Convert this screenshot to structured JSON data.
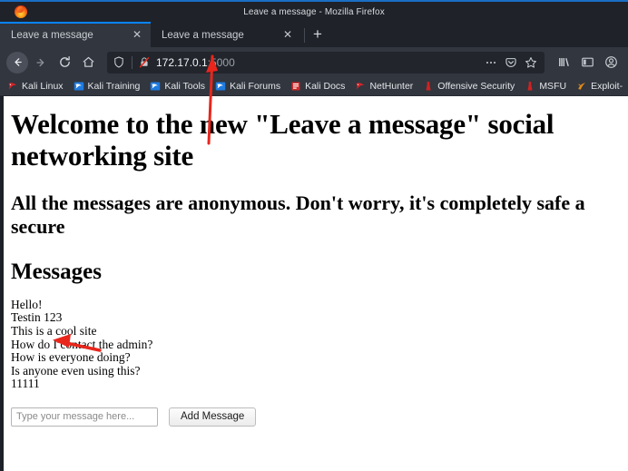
{
  "window": {
    "title": "Leave a message - Mozilla Firefox",
    "logo_icon": "firefox-logo"
  },
  "tabs": {
    "items": [
      {
        "label": "Leave a message",
        "close_icon": "close-icon",
        "active": true
      },
      {
        "label": "Leave a message",
        "close_icon": "close-icon",
        "active": false
      }
    ],
    "new_tab_label": "+"
  },
  "toolbar": {
    "back_icon": "back-arrow-icon",
    "forward_icon": "forward-arrow-icon",
    "reload_icon": "reload-icon",
    "home_icon": "home-icon",
    "shield_icon": "shield-icon",
    "lock_broken_icon": "lock-broken-icon",
    "url_host": "172.17.0.1",
    "url_port": ":5000",
    "page_actions_icon": "ellipsis-icon",
    "pocket_icon": "pocket-icon",
    "bookmark_star_icon": "star-icon",
    "library_icon": "library-icon",
    "sidebar_icon": "sidebar-icon",
    "account_icon": "account-icon"
  },
  "bookmarks": [
    {
      "label": "Kali Linux",
      "icon": "kali-dragon-icon"
    },
    {
      "label": "Kali Training",
      "icon": "kali-blue-icon"
    },
    {
      "label": "Kali Tools",
      "icon": "kali-blue-icon"
    },
    {
      "label": "Kali Forums",
      "icon": "kali-blue-icon"
    },
    {
      "label": "Kali Docs",
      "icon": "kali-docs-icon"
    },
    {
      "label": "NetHunter",
      "icon": "nethunter-icon"
    },
    {
      "label": "Offensive Security",
      "icon": "offsec-icon"
    },
    {
      "label": "MSFU",
      "icon": "offsec-icon"
    },
    {
      "label": "Exploit-",
      "icon": "exploitdb-icon"
    }
  ],
  "page": {
    "heading_line1": "Welcome to the new \"Leave a message\" social",
    "heading_line2": "networking site",
    "subheading_line1": "All the messages are anonymous. Don't worry, it's completely safe a",
    "subheading_line2": "secure",
    "messages_heading": "Messages",
    "messages": [
      "Hello!",
      "Testin 123",
      "This is a cool site",
      "How do I contact the admin?",
      "How is everyone doing?",
      "Is anyone even using this?",
      "11111"
    ],
    "input_placeholder": "Type your message here...",
    "input_value": "",
    "add_button_label": "Add Message"
  },
  "annotations": {
    "arrow_url_color": "#e8261c",
    "arrow_message_color": "#e8261c"
  }
}
